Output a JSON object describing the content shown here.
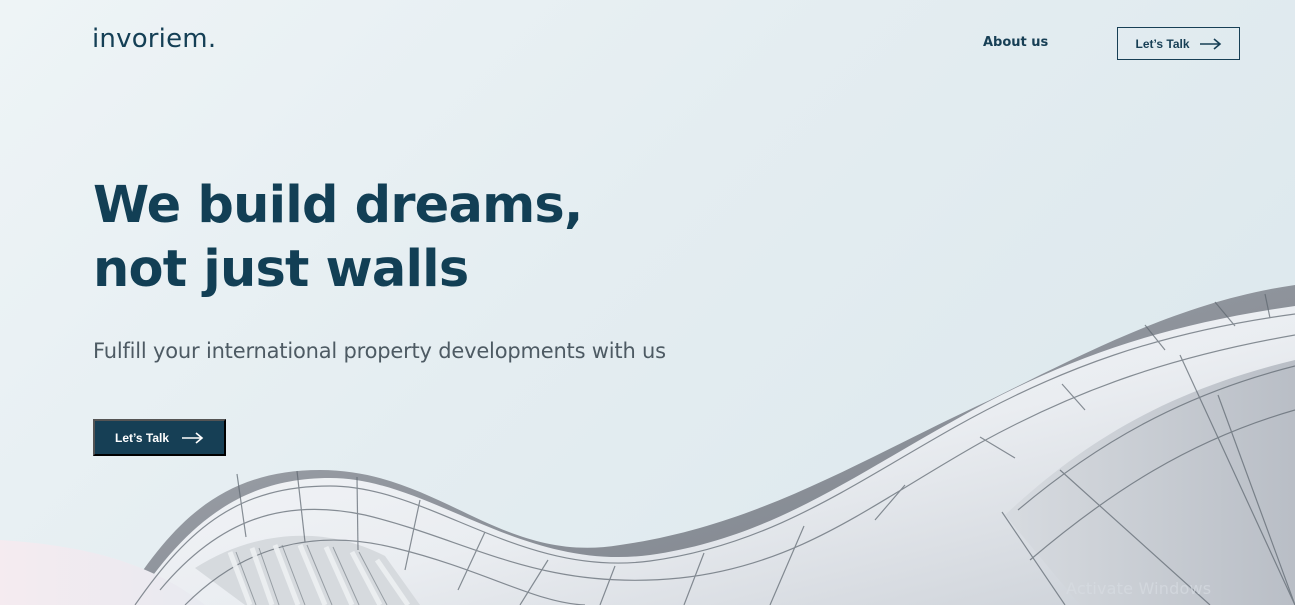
{
  "brand": {
    "logo": "invoriem.",
    "navy": "#143f55",
    "background": "#e8f0f3"
  },
  "nav": {
    "about_label": "About us",
    "talk_label": "Let’s Talk",
    "talk_icon": "arrow-right-icon"
  },
  "hero": {
    "title_line_1": "We build dreams,",
    "title_line_2": "not just walls",
    "subtitle": "Fulfill your international property developments with us",
    "cta_label": "Let’s Talk",
    "cta_icon": "arrow-right-icon"
  },
  "illustration": {
    "name": "wavy-white-building-facade"
  },
  "system": {
    "watermark": "Activate Windows"
  }
}
